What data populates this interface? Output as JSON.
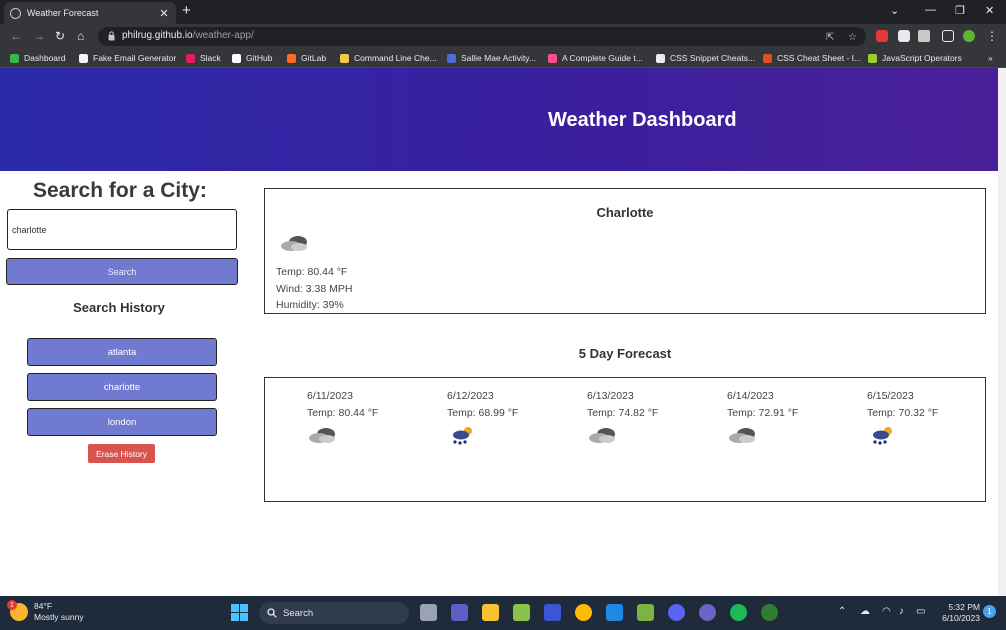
{
  "browser": {
    "tab_title": "Weather Forecast",
    "tab_close": "✕",
    "new_tab": "+",
    "url_host": "philrug.github.io",
    "url_path": "/weather-app/",
    "bookmarks": [
      {
        "label": "Dashboard",
        "color": "#3bb54a"
      },
      {
        "label": "Fake Email Generator",
        "color": "#f5f5f5"
      },
      {
        "label": "Slack",
        "color": "#e01e5a"
      },
      {
        "label": "GitHub",
        "color": "#ffffff"
      },
      {
        "label": "GitLab",
        "color": "#fc6d26"
      },
      {
        "label": "Command Line Che...",
        "color": "#f2c94c"
      },
      {
        "label": "Sallie Mae Activity...",
        "color": "#4b6bd6"
      },
      {
        "label": "A Complete Guide t...",
        "color": "#ff4d8d"
      },
      {
        "label": "CSS Snippet Cheats...",
        "color": "#e8eaed"
      },
      {
        "label": "CSS Cheat Sheet - I...",
        "color": "#e44d26"
      },
      {
        "label": "JavaScript Operators",
        "color": "#9acd32"
      }
    ]
  },
  "header": {
    "title": "Weather Dashboard"
  },
  "search": {
    "heading": "Search for a City:",
    "input_value": "charlotte",
    "button_label": "Search"
  },
  "history": {
    "heading": "Search History",
    "items": [
      "atlanta",
      "charlotte",
      "london"
    ],
    "erase_label": "Erase History"
  },
  "current": {
    "city": "Charlotte",
    "icon": "cloud-icon",
    "temp": "Temp: 80.44 °F",
    "wind": "Wind: 3.38 MPH",
    "humidity": "Humidity: 39%"
  },
  "forecast": {
    "heading": "5 Day Forecast",
    "days": [
      {
        "date": "6/11/2023",
        "temp": "Temp: 80.44 °F",
        "icon": "cloud-icon"
      },
      {
        "date": "6/12/2023",
        "temp": "Temp: 68.99 °F",
        "icon": "rain-sun-icon"
      },
      {
        "date": "6/13/2023",
        "temp": "Temp: 74.82 °F",
        "icon": "cloud-icon"
      },
      {
        "date": "6/14/2023",
        "temp": "Temp: 72.91 °F",
        "icon": "cloud-icon"
      },
      {
        "date": "6/15/2023",
        "temp": "Temp: 70.32 °F",
        "icon": "rain-sun-icon"
      }
    ]
  },
  "taskbar": {
    "weather_temp": "84°F",
    "weather_desc": "Mostly sunny",
    "search_label": "Search",
    "time": "5:32 PM",
    "date": "6/10/2023",
    "notification_count": "1",
    "weather_badge": "1"
  }
}
